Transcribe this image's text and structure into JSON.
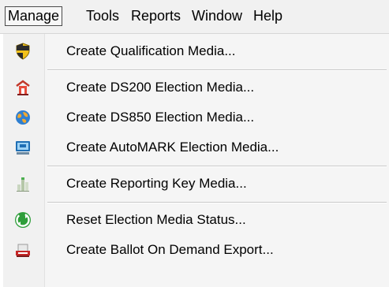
{
  "menubar": {
    "items": [
      "Manage",
      "Tools",
      "Reports",
      "Window",
      "Help"
    ],
    "active": "Manage"
  },
  "menu": {
    "items": [
      {
        "label": "Create Qualification Media...",
        "icon": "shield-icon"
      },
      {
        "label": "Create DS200 Election Media...",
        "icon": "ds200-icon"
      },
      {
        "label": "Create DS850 Election Media...",
        "icon": "ds850-globe-icon"
      },
      {
        "label": "Create AutoMARK Election Media...",
        "icon": "automark-icon"
      },
      {
        "label": "Create Reporting Key Media...",
        "icon": "reporting-key-icon"
      },
      {
        "label": "Reset Election Media Status...",
        "icon": "reset-refresh-icon"
      },
      {
        "label": "Create Ballot On Demand Export...",
        "icon": "pdf-export-icon"
      }
    ]
  },
  "colors": {
    "menubar_bg": "#f1f1f1",
    "menu_bg": "#f5f5f5",
    "separator": "#c9c9c9"
  }
}
